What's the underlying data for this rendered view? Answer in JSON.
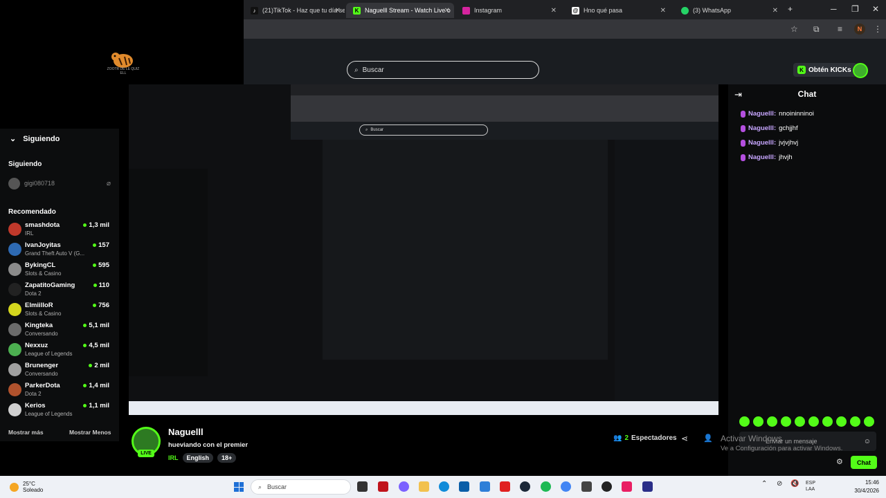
{
  "browser": {
    "tabs": [
      {
        "label": "(21)TikTok - Haz que tu día sea",
        "icon": "tiktok-icon"
      },
      {
        "label": "Naguelll Stream - Watch Live o",
        "icon": "kick-icon"
      },
      {
        "label": "Instagram",
        "icon": "instagram-icon"
      },
      {
        "label": "Hno qué pasa",
        "icon": "threads-icon"
      },
      {
        "label": "(3) WhatsApp",
        "icon": "whatsapp-icon"
      }
    ],
    "new_tab": "+",
    "profile_initial": "N"
  },
  "header": {
    "search_placeholder": "Buscar",
    "kicks_button": "Obtén KICKs"
  },
  "logo_caption": "ZOOTR DE LE QUIZ ELL",
  "sidebar": {
    "following_header": "Siguiendo",
    "following_section": "Siguiendo",
    "following_user": "gigi080718",
    "recommended_section": "Recomendado",
    "channels": [
      {
        "name": "smashdota",
        "category": "IRL",
        "viewers": "1,3 mil",
        "color": "#c0392b"
      },
      {
        "name": "IvanJoyitas",
        "category": "Grand Theft Auto V (G...",
        "viewers": "157",
        "color": "#2e6ab3"
      },
      {
        "name": "BykingCL",
        "category": "Slots & Casino",
        "viewers": "595",
        "color": "#8b8b8b"
      },
      {
        "name": "ZapatitoGaming",
        "category": "Dota 2",
        "viewers": "110",
        "color": "#222222"
      },
      {
        "name": "ElmiilloR",
        "category": "Slots & Casino",
        "viewers": "756",
        "color": "#d4d61e"
      },
      {
        "name": "Kingteka",
        "category": "Conversando",
        "viewers": "5,1 mil",
        "color": "#6b6b6b"
      },
      {
        "name": "Nexxuz",
        "category": "League of Legends",
        "viewers": "4,5 mil",
        "color": "#4caf50"
      },
      {
        "name": "Brunenger",
        "category": "Conversando",
        "viewers": "2 mil",
        "color": "#a0a0a0"
      },
      {
        "name": "ParkerDota",
        "category": "Dota 2",
        "viewers": "1,4 mil",
        "color": "#b0522d"
      },
      {
        "name": "Kerios",
        "category": "League of Legends",
        "viewers": "1,1 mil",
        "color": "#d0d0d0"
      }
    ],
    "show_more": "Mostrar más",
    "show_less": "Mostrar Menos"
  },
  "chat": {
    "title": "Chat",
    "messages": [
      {
        "user": "Naguelll:",
        "text": "nnoininninoi"
      },
      {
        "user": "Naguelll:",
        "text": "gchjjhf"
      },
      {
        "user": "Naguelll:",
        "text": "jvjvjhvj"
      },
      {
        "user": "Naguelll:",
        "text": "jhvjh"
      }
    ],
    "input_placeholder": "Enviar un mensaje",
    "send_button": "Chat"
  },
  "stream": {
    "streamer": "Naguelll",
    "title": "hueviando con el premier",
    "live_badge": "LIVE",
    "category": "IRL",
    "language": "English",
    "age": "18+",
    "viewer_count": "2",
    "viewer_label": "Espectadores"
  },
  "watermark": {
    "line1": "Activar Windows",
    "line2": "Ve a Configuración para activar Windows."
  },
  "taskbar": {
    "temperature": "25°C",
    "weather": "Soleado",
    "search_placeholder": "Buscar",
    "language": "ESP",
    "layout": "LAA",
    "time": "15:46",
    "date": "30/4/2026"
  }
}
